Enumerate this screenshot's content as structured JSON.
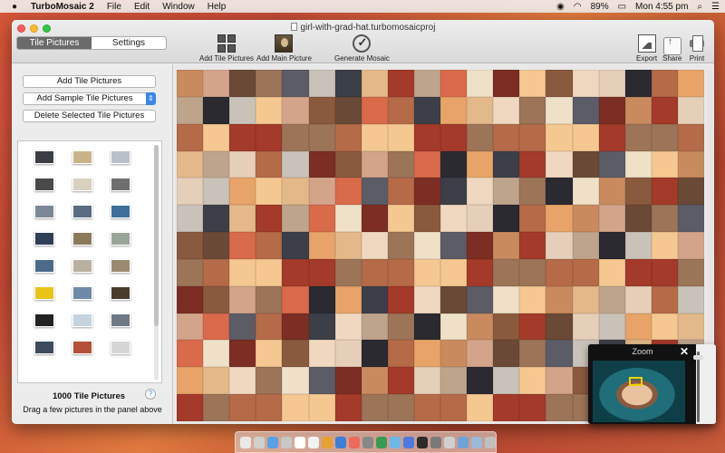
{
  "menubar": {
    "app_name": "TurboMosaic 2",
    "menus": [
      "File",
      "Edit",
      "Window",
      "Help"
    ],
    "battery": "89%",
    "clock": "Mon 4:55 pm"
  },
  "window": {
    "document_title": "girl-with-grad-hat.turbomosaicproj",
    "tabs": [
      {
        "label": "Tile Pictures",
        "active": true
      },
      {
        "label": "Settings",
        "active": false
      }
    ],
    "toolbar": {
      "add_tile_pictures": "Add Tile Pictures",
      "add_main_picture": "Add Main Picture",
      "generate_mosaic": "Generate Mosaic",
      "export": "Export",
      "share": "Share",
      "print": "Print"
    }
  },
  "left_panel": {
    "add_tile_button": "Add Tile Pictures",
    "add_sample_button": "Add Sample Tile Pictures",
    "delete_selected_button": "Delete Selected Tile Pictures",
    "tile_count": "1000 Tile Pictures",
    "help": "?",
    "hint": "Drag a few pictures in the panel above",
    "thumbnails": [
      "#3a3d44",
      "#c9b48a",
      "#b9c0c9",
      "#4a4a4a",
      "#d9d0c0",
      "#6e6e6e",
      "#7d8896",
      "#5a6b80",
      "#3f6f9a",
      "#2f3f57",
      "#8b7a5a",
      "#9aa59a",
      "#4c6a8a",
      "#b8b0a0",
      "#9c8a70",
      "#e8c417",
      "#6f8aa8",
      "#4a3d30",
      "#222222",
      "#c6d2de",
      "#707884",
      "#3c4c5c",
      "#b4503a",
      "#d6d6d6"
    ]
  },
  "zoom_panel": {
    "title": "Zoom",
    "close": "✕"
  },
  "dock": {
    "icons": [
      "#e9e9e9",
      "#cfcfcf",
      "#5aa0e6",
      "#c7c7c7",
      "#ffffff",
      "#f2f2f2",
      "#e8a030",
      "#3f7fd6",
      "#ec6a5e",
      "#888888",
      "#3a9a54",
      "#6bb8e8",
      "#4c7ae0",
      "#2c2c2c",
      "#7a7a7a",
      "#d0d0d0",
      "#6ea3d8",
      "#9bb9d8",
      "#c0c0c0"
    ]
  },
  "mosaic_palette": [
    "#c98b5e",
    "#e3b98a",
    "#8a5a3e",
    "#d4a48a",
    "#a33a2a",
    "#f0d8c0",
    "#6a4a36",
    "#bfa48c",
    "#e6cfb8",
    "#9c7458",
    "#d96a4a",
    "#2a2a30",
    "#5c5c66",
    "#efe0c8",
    "#b56a48",
    "#c9c2b8",
    "#7c2e24",
    "#e8a468",
    "#3c3f48",
    "#f4c890"
  ]
}
